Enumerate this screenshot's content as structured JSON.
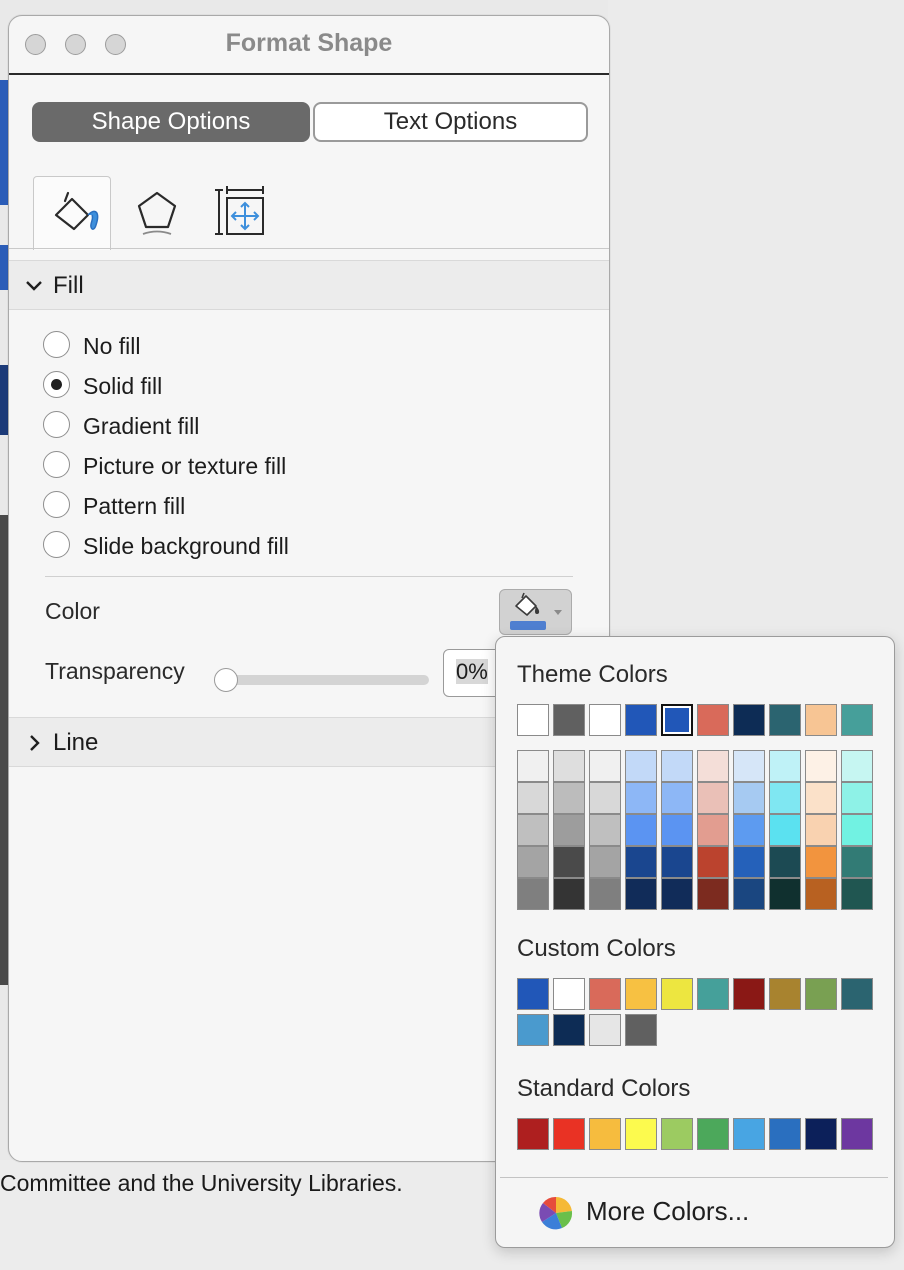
{
  "window": {
    "title": "Format Shape",
    "tabs": [
      {
        "label": "Shape Options",
        "active": true
      },
      {
        "label": "Text Options",
        "active": false
      }
    ],
    "icon_tabs": [
      {
        "icon": "fill-line-icon",
        "active": true
      },
      {
        "icon": "effects-pentagon-icon",
        "active": false
      },
      {
        "icon": "size-properties-icon",
        "active": false
      }
    ],
    "fill_section": {
      "label": "Fill",
      "expanded": true,
      "options": [
        {
          "label": "No fill",
          "selected": false
        },
        {
          "label": "Solid fill",
          "selected": true
        },
        {
          "label": "Gradient fill",
          "selected": false
        },
        {
          "label": "Picture or texture fill",
          "selected": false
        },
        {
          "label": "Pattern fill",
          "selected": false
        },
        {
          "label": "Slide background fill",
          "selected": false
        }
      ],
      "color_label": "Color",
      "transparency_label": "Transparency",
      "transparency_value": "0%",
      "transparency_fraction": 0
    },
    "line_section": {
      "label": "Line",
      "expanded": false
    }
  },
  "background_text": "Committee and the University Libraries.",
  "color_popup": {
    "theme_title": "Theme Colors",
    "theme_colors": [
      "#ffffff",
      "#606060",
      "#ffffff",
      "#2157b8",
      "#2157b8",
      "#d96a5a",
      "#0d2c55",
      "#2b6470",
      "#f7c594",
      "#469f9a"
    ],
    "theme_selected_index": 4,
    "theme_shades": [
      [
        "#f0f0f0",
        "#dedede",
        "#f0f0f0",
        "#c2d9f8",
        "#c2d9f8",
        "#f4ded8",
        "#d6e6f8",
        "#bff2f7",
        "#fdf1e6",
        "#c6f6f2"
      ],
      [
        "#d8d8d8",
        "#bcbcbc",
        "#d8d8d8",
        "#8db7f6",
        "#8db7f6",
        "#eac0b7",
        "#a6caf2",
        "#7fe7f2",
        "#fbe1c9",
        "#8ef2e7"
      ],
      [
        "#bfbfbf",
        "#9d9d9d",
        "#bfbfbf",
        "#5b94f2",
        "#5b94f2",
        "#e29d90",
        "#5d9bf0",
        "#5be1f0",
        "#f9d2b0",
        "#71f2e2"
      ],
      [
        "#a4a4a4",
        "#4a4a4a",
        "#a4a4a4",
        "#1a468f",
        "#1a468f",
        "#bb432e",
        "#2561ba",
        "#1c4a53",
        "#f2943e",
        "#327b75"
      ],
      [
        "#7f7f7f",
        "#343434",
        "#7f7f7f",
        "#112c59",
        "#112c59",
        "#7c2b1f",
        "#1a4680",
        "#10302f",
        "#b86121",
        "#205651"
      ]
    ],
    "custom_title": "Custom Colors",
    "custom_colors": [
      "#2157b8",
      "#ffffff",
      "#d96a5a",
      "#f7c142",
      "#ede640",
      "#45a09a",
      "#8a1815",
      "#a8832f",
      "#79a052",
      "#2b6470",
      "#4a9ace",
      "#0d2c55",
      "#e6e6e6",
      "#606060"
    ],
    "standard_title": "Standard Colors",
    "standard_colors": [
      "#ae1f1f",
      "#e93224",
      "#f6bc3e",
      "#fcfa4e",
      "#9ccb61",
      "#4ca85b",
      "#48a5e3",
      "#2a6fbf",
      "#0c205a",
      "#6d37a0"
    ],
    "more_label": "More Colors..."
  }
}
